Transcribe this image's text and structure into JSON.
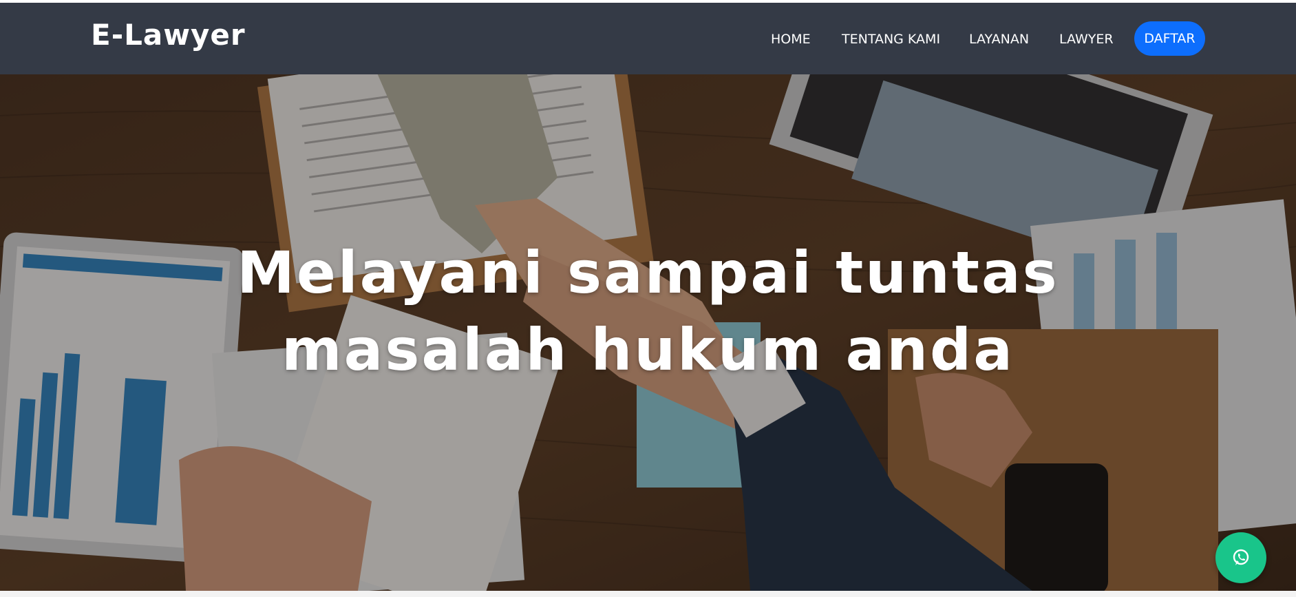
{
  "navbar": {
    "brand": "E-Lawyer",
    "links": [
      {
        "label": "HOME"
      },
      {
        "label": "TENTANG KAMI"
      },
      {
        "label": "LAYANAN"
      },
      {
        "label": "LAWYER"
      }
    ],
    "cta_label": "DAFTAR"
  },
  "hero": {
    "title_line1": "Melayani sampai tuntas",
    "title_line2": "masalah hukum anda",
    "background_image": "business-handshake-desk-photo"
  },
  "whatsapp": {
    "icon": "whatsapp-icon"
  },
  "colors": {
    "navbar_bg": "#343a46",
    "cta_bg": "#0d6efd",
    "whatsapp_bg": "#19c58a"
  }
}
